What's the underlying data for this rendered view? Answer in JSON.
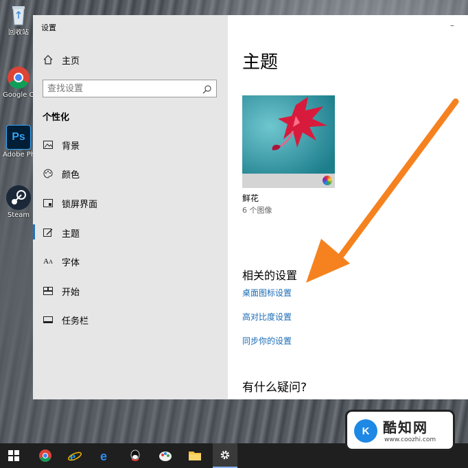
{
  "desktop_icons": [
    {
      "label": "回收站",
      "icon": "recycle-bin-icon"
    },
    {
      "label": "Google Chrome",
      "icon": "chrome-icon"
    },
    {
      "label": "Adobe Photosh",
      "icon": "photoshop-icon"
    },
    {
      "label": "Steam",
      "icon": "steam-icon"
    }
  ],
  "window": {
    "title": "设置",
    "minimize_glyph": "–"
  },
  "sidebar": {
    "home_label": "主页",
    "search_placeholder": "查找设置",
    "group_title": "个性化",
    "items": [
      {
        "label": "背景",
        "icon": "picture-icon"
      },
      {
        "label": "颜色",
        "icon": "palette-icon"
      },
      {
        "label": "锁屏界面",
        "icon": "lock-screen-icon"
      },
      {
        "label": "主题",
        "icon": "theme-icon",
        "selected": true
      },
      {
        "label": "字体",
        "icon": "font-icon"
      },
      {
        "label": "开始",
        "icon": "start-icon"
      },
      {
        "label": "任务栏",
        "icon": "taskbar-icon"
      }
    ]
  },
  "main": {
    "page_title": "主题",
    "theme": {
      "name": "鲜花",
      "subtitle": "6 个图像"
    },
    "related_title": "相关的设置",
    "links": [
      "桌面图标设置",
      "高对比度设置",
      "同步你的设置"
    ],
    "help_title": "有什么疑问?"
  },
  "taskbar": {
    "icons": [
      "windows-start-icon",
      "chrome-icon",
      "internet-explorer-icon",
      "edge-icon",
      "qq-icon",
      "paint-icon",
      "file-explorer-icon",
      "settings-gear-icon"
    ]
  },
  "watermark": {
    "logo_text": "K",
    "title": "酷知网",
    "url": "www.coozhi.com"
  },
  "colors": {
    "accent": "#1a6bb5",
    "arrow": "#f5821f",
    "sidebar_bg": "#e6e6e6",
    "taskbar_bg": "#1f1f1f"
  }
}
